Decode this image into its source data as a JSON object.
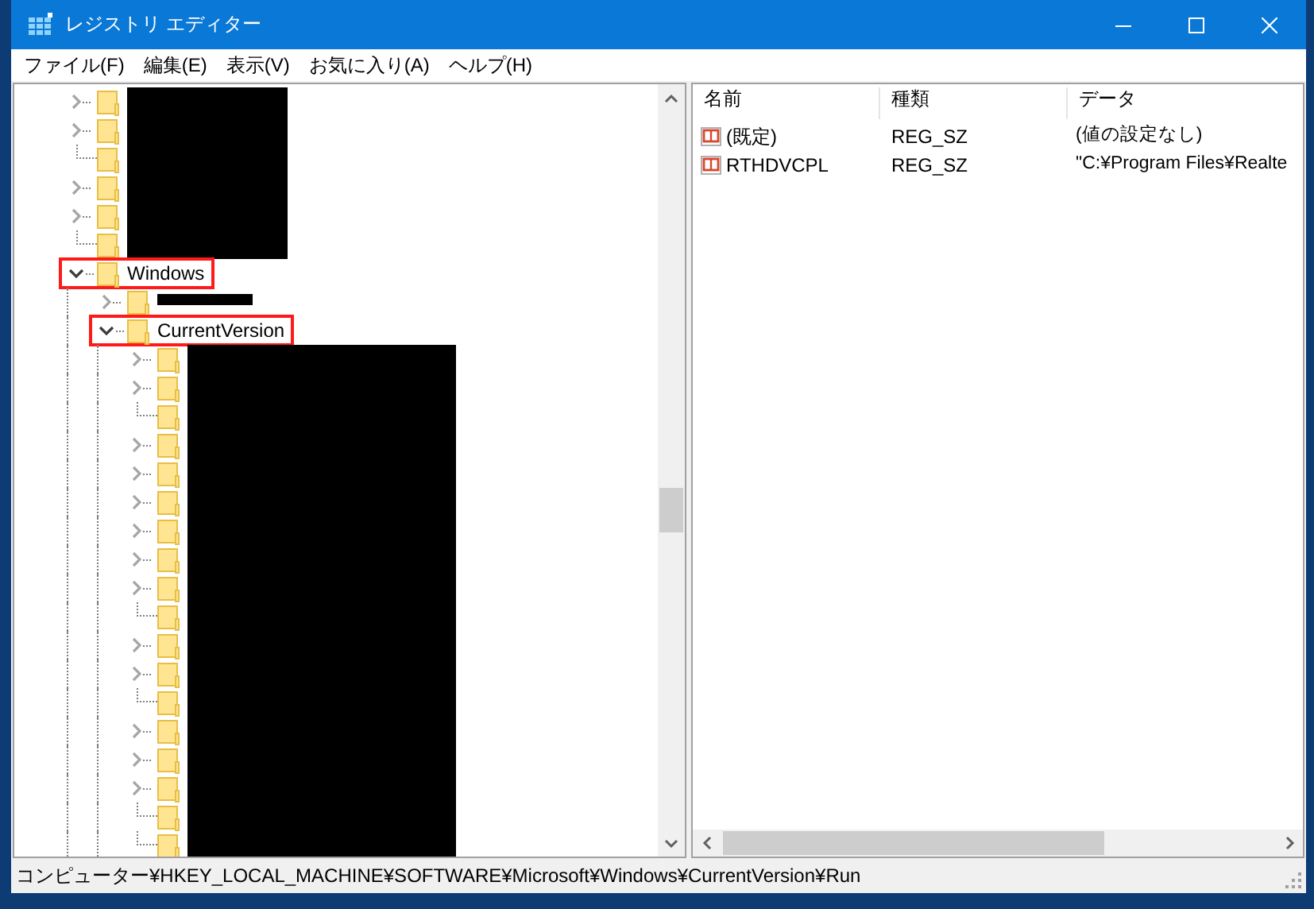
{
  "window": {
    "title": "レジストリ エディター"
  },
  "menu": [
    {
      "label": "ファイル(F)"
    },
    {
      "label": "編集(E)"
    },
    {
      "label": "表示(V)"
    },
    {
      "label": "お気に入り(A)"
    },
    {
      "label": "ヘルプ(H)"
    }
  ],
  "tree": {
    "items": [
      {
        "redacted": true,
        "kind": "collapsed",
        "highlighted": false
      },
      {
        "redacted": true,
        "kind": "collapsed",
        "highlighted": false
      },
      {
        "redacted": true,
        "kind": "leaf",
        "highlighted": false
      },
      {
        "redacted": true,
        "kind": "collapsed",
        "highlighted": false
      },
      {
        "redacted": true,
        "kind": "collapsed",
        "highlighted": false
      },
      {
        "redacted": true,
        "kind": "leaf",
        "highlighted": false
      },
      {
        "label": "Windows",
        "kind": "expanded",
        "highlighted": true,
        "children": [
          {
            "redacted": true,
            "kind": "collapsed",
            "highlighted": false
          },
          {
            "label": "CurrentVersion",
            "kind": "expanded",
            "highlighted": true,
            "children": [
              {
                "redacted": true,
                "kind": "collapsed",
                "highlighted": false
              },
              {
                "redacted": true,
                "kind": "collapsed",
                "highlighted": false
              },
              {
                "redacted": true,
                "kind": "leaf",
                "highlighted": false
              },
              {
                "redacted": true,
                "kind": "collapsed",
                "highlighted": false
              },
              {
                "redacted": true,
                "kind": "collapsed",
                "highlighted": false
              },
              {
                "redacted": true,
                "kind": "collapsed",
                "highlighted": false
              },
              {
                "redacted": true,
                "kind": "collapsed",
                "highlighted": false
              },
              {
                "redacted": true,
                "kind": "collapsed",
                "highlighted": false
              },
              {
                "redacted": true,
                "kind": "collapsed",
                "highlighted": false
              },
              {
                "redacted": true,
                "kind": "leaf",
                "highlighted": false
              },
              {
                "redacted": true,
                "kind": "collapsed",
                "highlighted": false
              },
              {
                "redacted": true,
                "kind": "collapsed",
                "highlighted": false
              },
              {
                "redacted": true,
                "kind": "leaf",
                "highlighted": false
              },
              {
                "redacted": true,
                "kind": "collapsed",
                "highlighted": false
              },
              {
                "redacted": true,
                "kind": "collapsed",
                "highlighted": false
              },
              {
                "redacted": true,
                "kind": "collapsed",
                "highlighted": false
              },
              {
                "redacted": true,
                "kind": "leaf",
                "highlighted": false
              },
              {
                "redacted": true,
                "kind": "leaf",
                "highlighted": false
              }
            ]
          }
        ]
      }
    ]
  },
  "values": {
    "columns": [
      "名前",
      "種類",
      "データ"
    ],
    "rows": [
      {
        "name": "(既定)",
        "type": "REG_SZ",
        "data": "(値の設定なし)"
      },
      {
        "name": "RTHDVCPL",
        "type": "REG_SZ",
        "data": "\"C:¥Program Files¥Realte"
      }
    ]
  },
  "status_bar": "コンピューター¥HKEY_LOCAL_MACHINE¥SOFTWARE¥Microsoft¥Windows¥CurrentVersion¥Run"
}
